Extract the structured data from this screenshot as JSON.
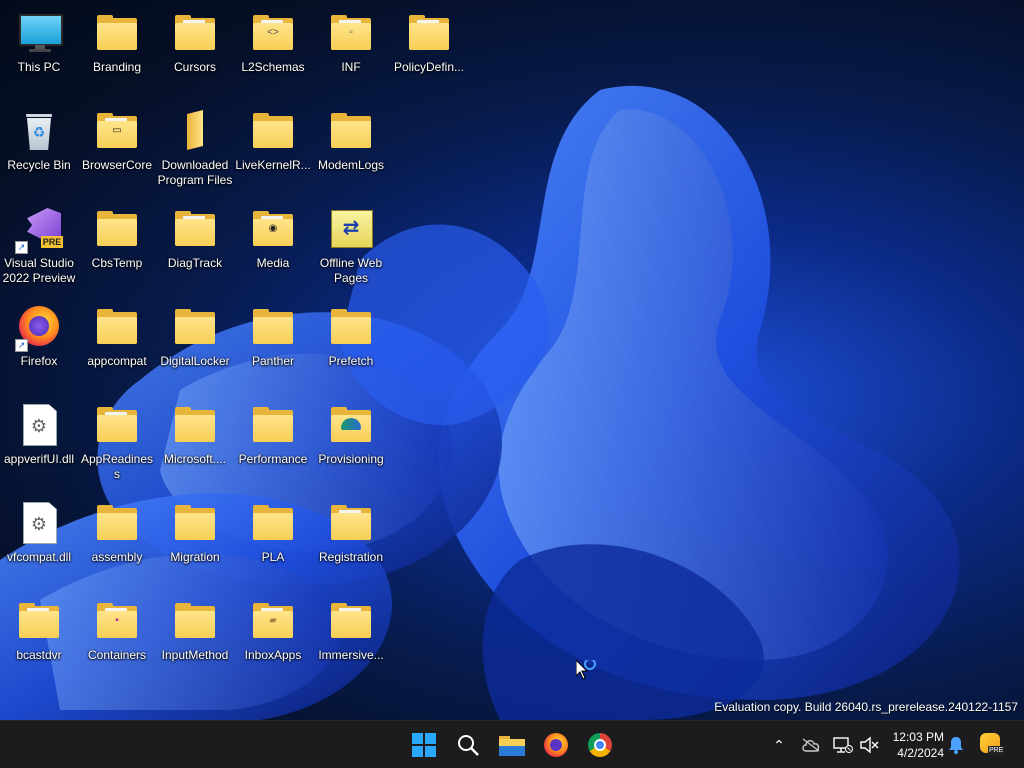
{
  "desktop": {
    "icons": [
      {
        "label": "This PC"
      },
      {
        "label": "Branding"
      },
      {
        "label": "Cursors"
      },
      {
        "label": "L2Schemas"
      },
      {
        "label": "INF"
      },
      {
        "label": "PolicyDefin..."
      },
      {
        "label": "Recycle Bin"
      },
      {
        "label": "BrowserCore"
      },
      {
        "label": "Downloaded Program Files"
      },
      {
        "label": "LiveKernelR..."
      },
      {
        "label": "ModemLogs"
      },
      {
        "label": "Visual Studio 2022 Preview"
      },
      {
        "label": "CbsTemp"
      },
      {
        "label": "DiagTrack"
      },
      {
        "label": "Media"
      },
      {
        "label": "Offline Web Pages"
      },
      {
        "label": "Firefox"
      },
      {
        "label": "appcompat"
      },
      {
        "label": "DigitalLocker"
      },
      {
        "label": "Panther"
      },
      {
        "label": "Prefetch"
      },
      {
        "label": "appverifUI.dll"
      },
      {
        "label": "AppReadiness"
      },
      {
        "label": "Microsoft...."
      },
      {
        "label": "Performance"
      },
      {
        "label": "Provisioning"
      },
      {
        "label": "vfcompat.dll"
      },
      {
        "label": "assembly"
      },
      {
        "label": "Migration"
      },
      {
        "label": "PLA"
      },
      {
        "label": "Registration"
      },
      {
        "label": "bcastdvr"
      },
      {
        "label": "Containers"
      },
      {
        "label": "InputMethod"
      },
      {
        "label": "InboxApps"
      },
      {
        "label": "Immersive..."
      }
    ],
    "vs_badge": "PRE",
    "watermark": "Evaluation copy. Build 26040.rs_prerelease.240122-1157"
  },
  "taskbar": {
    "clock_time": "12:03 PM",
    "clock_date": "4/2/2024",
    "copilot_badge": "PRE"
  },
  "colors": {
    "taskbar_bg": "#1c1c1c",
    "folder": "#f7cf55",
    "accent": "#1d4fd8"
  }
}
